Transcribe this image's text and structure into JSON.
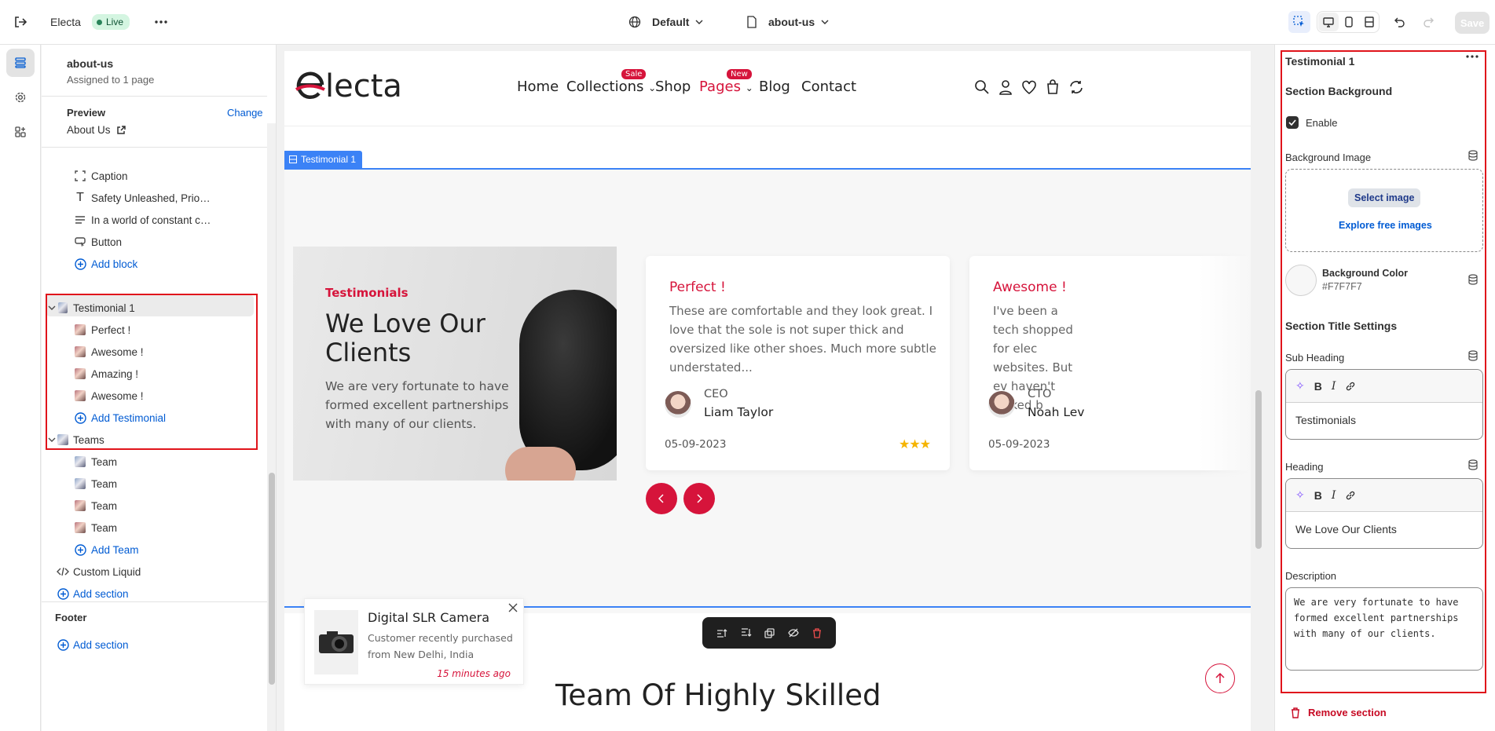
{
  "topbar": {
    "app_name": "Electa",
    "live_label": "Live",
    "theme_label": "Default",
    "page_label": "about-us",
    "save_label": "Save"
  },
  "sidebar": {
    "page_title": "about-us",
    "page_subtitle": "Assigned to 1 page",
    "preview_label": "Preview",
    "change_label": "Change",
    "preview_value": "About Us",
    "items": [
      {
        "label": "Caption",
        "icon": "caption-icon"
      },
      {
        "label": "Safety Unleashed, Priority ...",
        "icon": "text-icon"
      },
      {
        "label": "In a world of constant chan...",
        "icon": "paragraph-icon"
      },
      {
        "label": "Button",
        "icon": "button-icon"
      },
      {
        "label": "Add block",
        "icon": "plus-circle-icon"
      },
      {
        "label": "Testimonial 1",
        "icon": "section-icon"
      },
      {
        "label": "Perfect !",
        "icon": "testimonial-thumb"
      },
      {
        "label": "Awesome !",
        "icon": "testimonial-thumb"
      },
      {
        "label": "Amazing !",
        "icon": "testimonial-thumb"
      },
      {
        "label": "Awesome !",
        "icon": "testimonial-thumb"
      },
      {
        "label": "Add Testimonial",
        "icon": "plus-circle-icon"
      },
      {
        "label": "Teams",
        "icon": "section-icon"
      },
      {
        "label": "Team",
        "icon": "team-thumb"
      },
      {
        "label": "Team",
        "icon": "team-thumb"
      },
      {
        "label": "Team",
        "icon": "team-thumb"
      },
      {
        "label": "Team",
        "icon": "team-thumb"
      },
      {
        "label": "Add Team",
        "icon": "plus-circle-icon"
      },
      {
        "label": "Custom Liquid",
        "icon": "code-icon"
      },
      {
        "label": "Add section",
        "icon": "plus-circle-icon"
      }
    ],
    "footer_label": "Footer",
    "footer_add": "Add section"
  },
  "site": {
    "logo": "electa",
    "nav": [
      {
        "label": "Home"
      },
      {
        "label": "Collections",
        "badge": "Sale"
      },
      {
        "label": "Shop"
      },
      {
        "label": "Pages",
        "badge": "New"
      },
      {
        "label": "Blog"
      },
      {
        "label": "Contact"
      }
    ],
    "section_tag": "Testimonial 1",
    "sub_heading": "Testimonials",
    "heading_line1": "We Love Our",
    "heading_line2": "Clients",
    "description": "We are very fortunate to have formed excellent partnerships with many of our clients.",
    "cards": [
      {
        "title": "Perfect !",
        "text": "These are comfortable and they look great. I love that the sole is not super thick and oversized like other shoes. Much more subtle understated...",
        "role": "CEO",
        "name": "Liam Taylor",
        "date": "05-09-2023"
      },
      {
        "title": "Awesome !",
        "text": "I've been a tech shopped for elec websites. But ev haven't looked b",
        "role": "CTO",
        "name": "Noah Lev",
        "date": "05-09-2023"
      }
    ],
    "popup": {
      "title": "Digital SLR Camera",
      "line1": "Customer recently purchased",
      "line2": "from New Delhi, India",
      "time": "15 minutes ago"
    },
    "team_heading": "Team Of Highly Skilled"
  },
  "panel": {
    "title": "Testimonial 1",
    "section_background": "Section Background",
    "enable_label": "Enable",
    "background_image": "Background Image",
    "select_image": "Select image",
    "explore_images": "Explore free images",
    "background_color_label": "Background Color",
    "background_color_value": "#F7F7F7",
    "title_settings": "Section Title Settings",
    "sub_heading_label": "Sub Heading",
    "sub_heading_value": "Testimonials",
    "heading_label": "Heading",
    "heading_value": "We Love Our Clients",
    "description_label": "Description",
    "description_value": "We are very fortunate to have formed excellent partnerships with many of our clients.",
    "remove_section": "Remove section"
  },
  "colors": {
    "brand_red": "#d6143b",
    "selection_blue": "#3b82f6",
    "highlight_red": "#e0141b",
    "link_blue": "#005bd3"
  }
}
